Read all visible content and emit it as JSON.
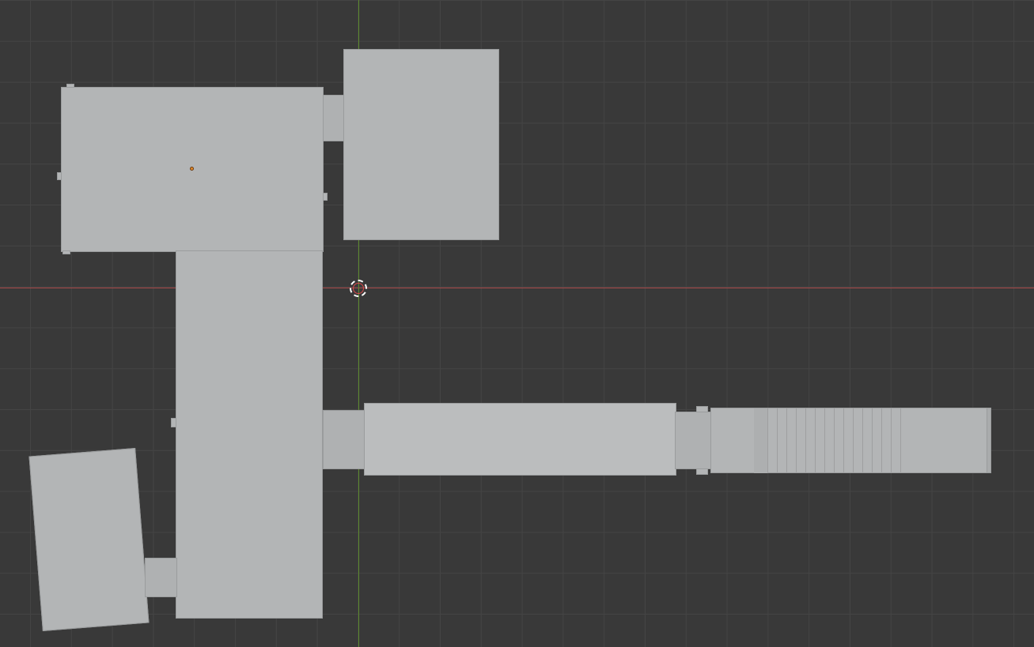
{
  "viewport": {
    "background": "#393939",
    "grid_color": "#444444",
    "x_axis_color": "#a84a4a",
    "y_axis_color": "#5e8a2e",
    "origin_color": "#e08a2c",
    "object_color": "#b3b5b6"
  },
  "cursor": {
    "icon": "3d-cursor-icon"
  }
}
